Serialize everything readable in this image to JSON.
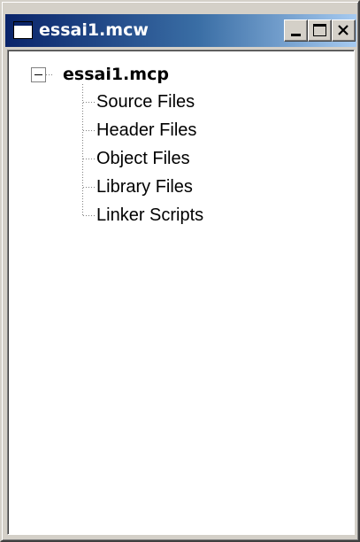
{
  "window": {
    "title": "essai1.mcw",
    "title_icon": "window-icon",
    "controls": [
      "minimize-icon",
      "maximize-icon",
      "close-icon"
    ]
  },
  "tree": {
    "root": {
      "label": "essai1.mcp",
      "expanded": true
    },
    "children": [
      {
        "label": "Source Files"
      },
      {
        "label": "Header Files"
      },
      {
        "label": "Object Files"
      },
      {
        "label": "Library Files"
      },
      {
        "label": "Linker Scripts"
      }
    ]
  },
  "colors": {
    "titlebar_start": "#0a246a",
    "titlebar_end": "#a6caf0",
    "face": "#d4d0c8",
    "content_bg": "#ffffff"
  }
}
